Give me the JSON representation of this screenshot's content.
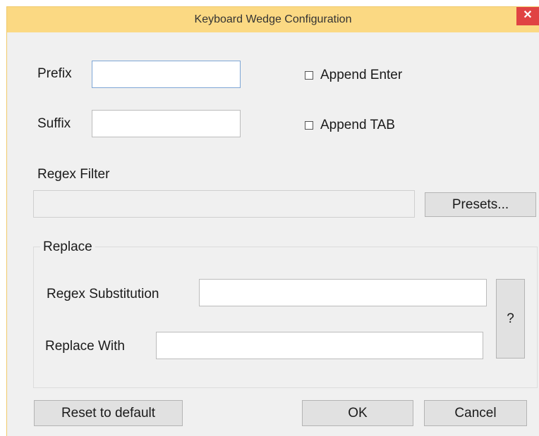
{
  "window": {
    "title": "Keyboard Wedge Configuration",
    "close_glyph": "✕"
  },
  "colors": {
    "titlebar": "#fbd983",
    "close_button": "#e04343",
    "dialog_background": "#f0f0f0"
  },
  "form": {
    "prefix_label": "Prefix",
    "prefix_value": "",
    "suffix_label": "Suffix",
    "suffix_value": "",
    "append_enter_label": "Append Enter",
    "append_enter_checked": false,
    "append_tab_label": "Append TAB",
    "append_tab_checked": false,
    "regex_filter_label": "Regex Filter",
    "regex_filter_value": "",
    "presets_button": "Presets..."
  },
  "replace_group": {
    "title": "Replace",
    "regex_substitution_label": "Regex Substitution",
    "regex_substitution_value": "",
    "replace_with_label": "Replace With",
    "replace_with_value": "",
    "help_button": "?"
  },
  "footer": {
    "reset_button": "Reset to default",
    "ok_button": "OK",
    "cancel_button": "Cancel"
  }
}
